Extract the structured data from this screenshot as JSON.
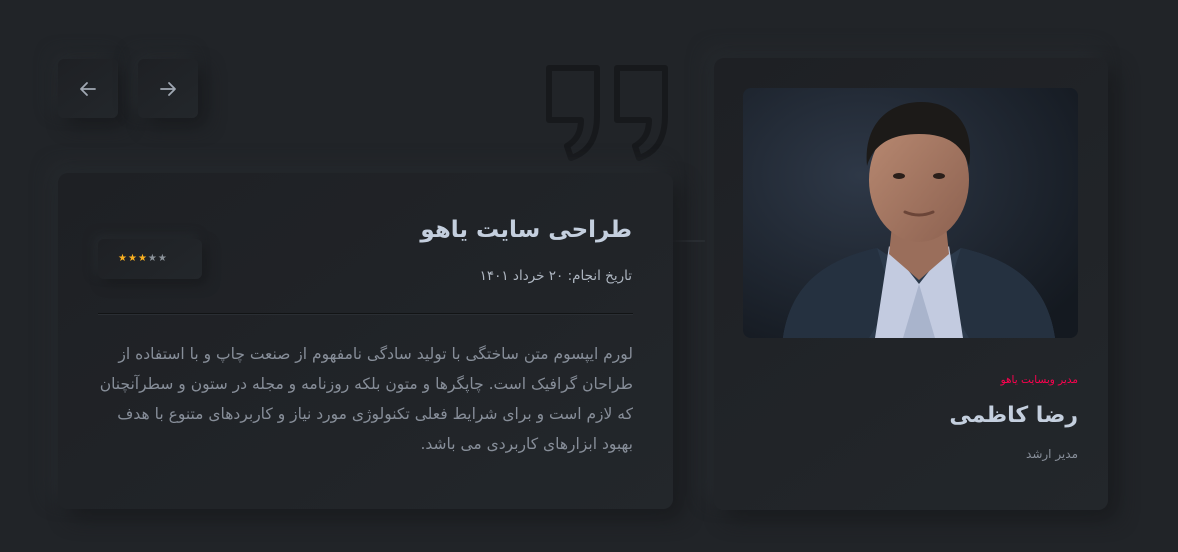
{
  "navigation": {
    "prev_icon": "arrow-left-icon",
    "next_icon": "arrow-right-icon"
  },
  "decoration": {
    "quote_icon": "quote-icon"
  },
  "testimonial": {
    "title": "طراحی سایت یاهو",
    "date": "تاریخ انجام: ۲۰ خرداد ۱۴۰۱",
    "rating": 3,
    "rating_max": 5,
    "text": "لورم ایپسوم متن ساختگی با تولید سادگی نامفهوم از صنعت چاپ و با استفاده از طراحان گرافیک است. چاپگرها و متون بلکه روزنامه و مجله در ستون و سطرآنچنان که لازم است و برای شرایط فعلی تکنولوژی مورد نیاز و کاربردهای متنوع با هدف بهبود ابزارهای کاربردی می باشد."
  },
  "profile": {
    "photo": "person-photo",
    "company": "مدیر وبسایت یاهو",
    "name": "رضا کاظمی",
    "role": "مدیر ارشد"
  },
  "colors": {
    "background": "#212428",
    "accent": "#ff014f",
    "star_filled": "#f9b021",
    "star_empty": "#8b929a",
    "heading": "#c4cfde",
    "body_text": "#878e99"
  }
}
